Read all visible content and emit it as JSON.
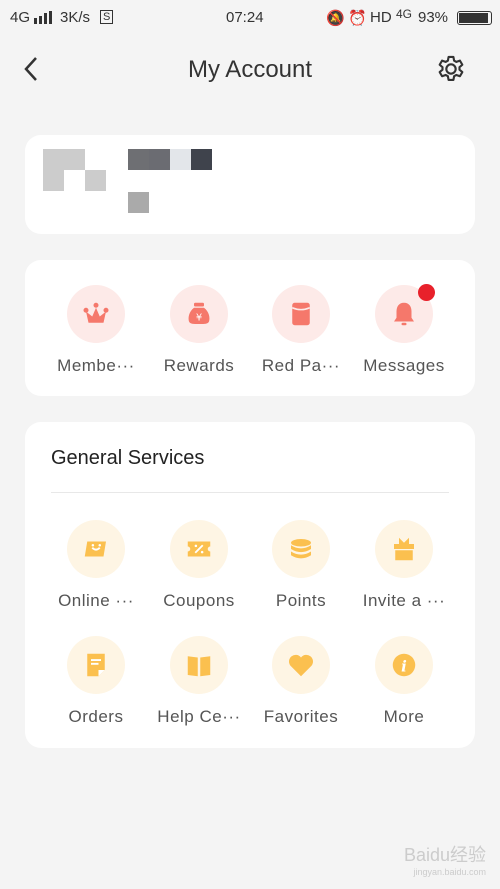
{
  "status_bar": {
    "network": "4G",
    "speed": "3K/s",
    "time": "07:24",
    "hd": "HD",
    "network2": "4G",
    "battery": "93%"
  },
  "header": {
    "title": "My Account"
  },
  "quick_actions": [
    {
      "label": "Membe···",
      "icon": "crown-icon"
    },
    {
      "label": "Rewards",
      "icon": "money-bag-icon"
    },
    {
      "label": "Red Pa···",
      "icon": "red-packet-icon"
    },
    {
      "label": "Messages",
      "icon": "bell-icon",
      "badge": true
    }
  ],
  "services": {
    "title": "General Services",
    "items": [
      {
        "label": "Online ···",
        "icon": "smile-card-icon"
      },
      {
        "label": "Coupons",
        "icon": "coupon-icon"
      },
      {
        "label": "Points",
        "icon": "coins-icon"
      },
      {
        "label": "Invite a ···",
        "icon": "gift-icon"
      },
      {
        "label": "Orders",
        "icon": "document-icon"
      },
      {
        "label": "Help Ce···",
        "icon": "book-icon"
      },
      {
        "label": "Favorites",
        "icon": "heart-icon"
      },
      {
        "label": "More",
        "icon": "info-icon"
      }
    ]
  },
  "colors": {
    "red_accent": "#f5786b",
    "yellow_accent": "#fbc04f",
    "badge": "#e8212b"
  },
  "watermark": {
    "brand": "Baidu经验",
    "url": "jingyan.baidu.com"
  }
}
